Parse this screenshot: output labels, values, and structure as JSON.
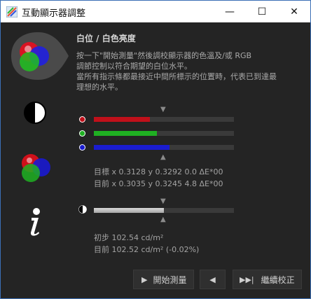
{
  "window": {
    "title": "互動顯示器調整",
    "minimize": "—",
    "maximize": "☐",
    "close": "✕"
  },
  "heading": "白位 / 白色亮度",
  "description": "按一下\"開始測量\"然後調校顯示器的色溫及/或 RGB\n調節控制以符合期望的白位水平。\n當所有指示條都最接近中間所標示的位置時，代表已到達最\n理想的水平。",
  "rgb": {
    "red": {
      "value": 0.4,
      "color": "#c0101a"
    },
    "green": {
      "value": 0.45,
      "color": "#1fb022"
    },
    "blue": {
      "value": 0.54,
      "color": "#1a1ccf"
    }
  },
  "readouts": {
    "target": "目標 x 0.3128 y 0.3292 0.0 ΔE*00",
    "current": "目前 x 0.3035 y 0.3245 4.8 ΔE*00"
  },
  "luminance": {
    "value": 0.5,
    "initial": "初步 102.54 cd/m²",
    "current": "目前 102.52 cd/m² (-0.02%)"
  },
  "buttons": {
    "start": {
      "label": "開始測量",
      "glyph": "▶"
    },
    "back": {
      "glyph": "◀"
    },
    "continue": {
      "label": "繼續校正",
      "glyph": "▶▶|"
    }
  },
  "icons": {
    "rgb_large": "rgb-circles-icon",
    "contrast": "contrast-icon",
    "rgb_small": "rgb-circles-icon",
    "info": "info-icon"
  }
}
